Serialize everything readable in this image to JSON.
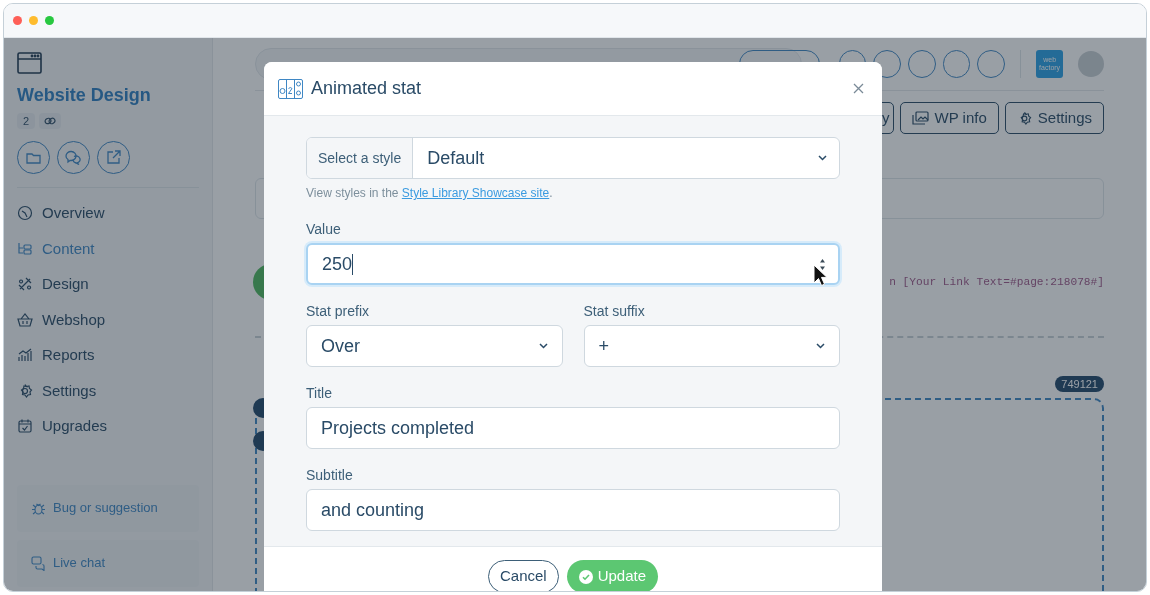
{
  "sidebar": {
    "project_title": "Website Design",
    "count": "2",
    "items": [
      {
        "label": "Overview",
        "selected": false
      },
      {
        "label": "Content",
        "selected": true
      },
      {
        "label": "Design",
        "selected": false
      },
      {
        "label": "Webshop",
        "selected": false
      },
      {
        "label": "Reports",
        "selected": false
      },
      {
        "label": "Settings",
        "selected": false
      },
      {
        "label": "Upgrades",
        "selected": false
      }
    ],
    "footer_buttons": [
      "Bug or suggestion",
      "Live chat"
    ]
  },
  "header": {
    "logo_text": "web factory"
  },
  "toolbar_buttons": [
    "y",
    "WP info",
    "Settings"
  ],
  "content": {
    "link_code": "n [Your Link Text=#page:218078#]",
    "block_id": "749121"
  },
  "modal": {
    "title": "Animated stat",
    "style_label": "Select a style",
    "style_value": "Default",
    "help": {
      "before": "View styles in the ",
      "link": "Style Library Showcase site",
      "after": "."
    },
    "value_label": "Value",
    "value": "250",
    "value_focused": true,
    "prefix_label": "Stat prefix",
    "prefix_value": "Over",
    "suffix_label": "Stat suffix",
    "suffix_value": "+",
    "title_label": "Title",
    "title_value": "Projects completed",
    "subtitle_label": "Subtitle",
    "subtitle_value": "and counting",
    "buttons": {
      "cancel": "Cancel",
      "update": "Update"
    }
  }
}
